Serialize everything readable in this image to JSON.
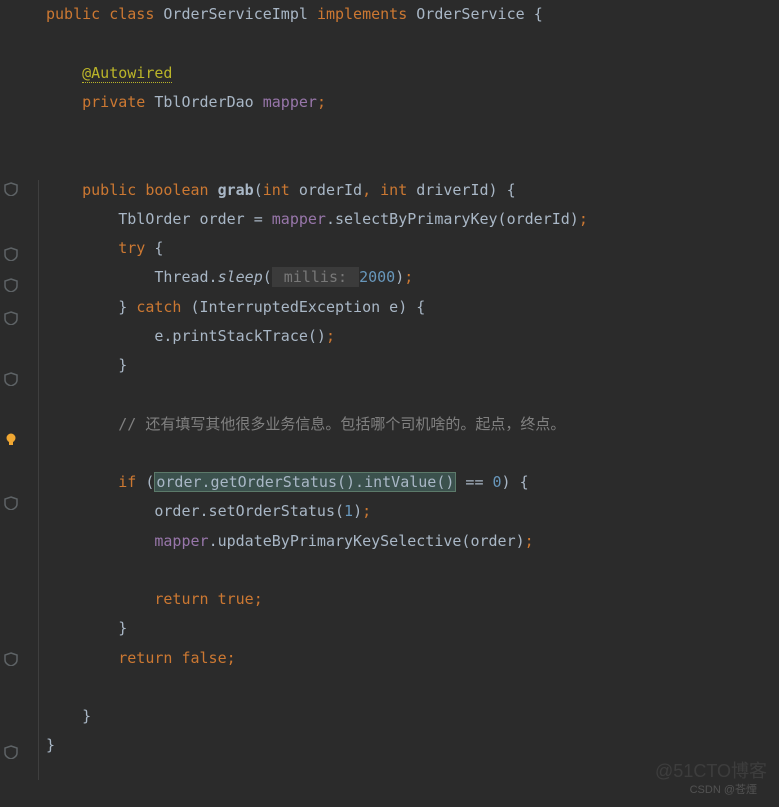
{
  "code": {
    "l1_public": "public",
    "l1_class": "class",
    "l1_name": "OrderServiceImpl",
    "l1_implements": "implements",
    "l1_iface": "OrderService",
    "l1_brace": "{",
    "annotation": "@Autowired",
    "l4_private": "private",
    "l4_type": "TblOrderDao",
    "l4_field": "mapper",
    "l4_semi": ";",
    "l7_public": "public",
    "l7_bool": "boolean",
    "l7_name": "grab",
    "l7_p1": "(",
    "l7_int1": "int",
    "l7_arg1": "orderId",
    "l7_comma": ",",
    "l7_int2": "int",
    "l7_arg2": "driverId)",
    "l7_brace": "{",
    "l8_pre": "TblOrder order = ",
    "l8_mapper": "mapper",
    "l8_call": ".selectByPrimaryKey(orderId)",
    "l8_semi": ";",
    "l9_try": "try",
    "l9_brace": "{",
    "l10_pre": "Thread.",
    "l10_sleep": "sleep",
    "l10_open": "(",
    "l10_hint": " millis: ",
    "l10_num": "2000",
    "l10_close": ")",
    "l10_semi": ";",
    "l11_close": "}",
    "l11_catch": "catch",
    "l11_rest": "(InterruptedException e) {",
    "l12": "e.printStackTrace()",
    "l12_semi": ";",
    "l13": "}",
    "comment": "// 还有填写其他很多业务信息。包括哪个司机啥的。起点，终点。",
    "l17_if": "if",
    "l17_open": "(",
    "l17_hl": "order.getOrderStatus().intValue()",
    "l17_eq": " == ",
    "l17_zero": "0",
    "l17_close": ") {",
    "l18_pre": "order.setOrderStatus(",
    "l18_one": "1",
    "l18_close": ")",
    "l18_semi": ";",
    "l19_mapper": "mapper",
    "l19_call": ".updateByPrimaryKeySelective(order)",
    "l19_semi": ";",
    "l21_return": "return",
    "l21_true": "true",
    "l21_semi": ";",
    "l22": "}",
    "l23_return": "return",
    "l23_false": "false",
    "l23_semi": ";",
    "l25": "}",
    "l27": "}"
  },
  "watermarks": {
    "top": "@51CTO博客",
    "bottom": "CSDN @苍煙"
  },
  "gutter_positions": {
    "shield1": 182,
    "shield2": 247,
    "shield3": 278,
    "shield4": 311,
    "shield5": 372,
    "bulb": 432,
    "shield6": 496,
    "shield7": 652,
    "shield8": 745
  }
}
